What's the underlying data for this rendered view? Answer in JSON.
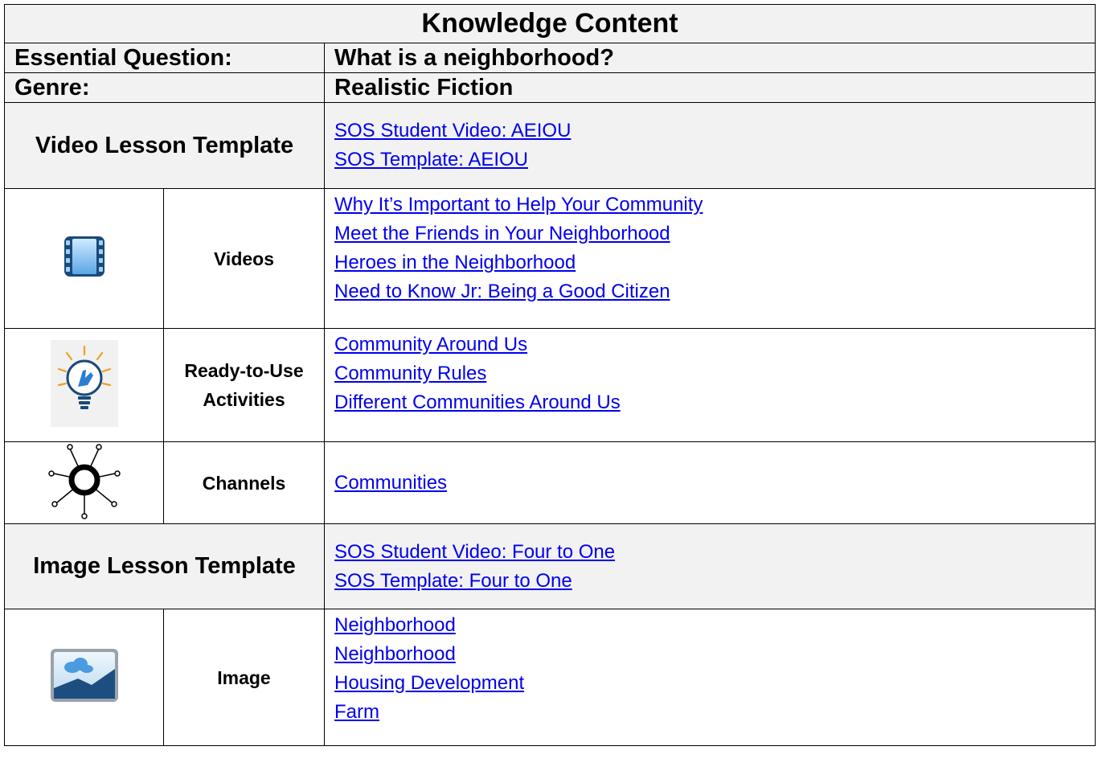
{
  "title": "Knowledge Content",
  "essential_question": {
    "label": "Essential Question:",
    "value": "What is a neighborhood?"
  },
  "genre": {
    "label": "Genre:",
    "value": "Realistic Fiction"
  },
  "video_lesson": {
    "label": "Video Lesson Template",
    "links": [
      "SOS Student Video:  AEIOU",
      "SOS Template:  AEIOU"
    ]
  },
  "videos": {
    "label": "Videos",
    "icon": "film-strip-icon",
    "links": [
      "Why It’s Important to Help Your Community",
      "Meet the Friends in Your Neighborhood",
      "Heroes in the Neighborhood",
      "Need to Know Jr:  Being a Good Citizen"
    ]
  },
  "activities": {
    "label_line1": "Ready-to-Use",
    "label_line2": "Activities",
    "icon": "lightbulb-hand-icon",
    "links": [
      "Community Around Us",
      "Community Rules",
      "Different Communities Around Us"
    ]
  },
  "channels": {
    "label": "Channels",
    "icon": "hub-network-icon",
    "links": [
      "Communities"
    ]
  },
  "image_lesson": {
    "label": "Image Lesson Template",
    "links": [
      "SOS Student Video:  Four to One",
      "SOS Template:  Four to One"
    ]
  },
  "images": {
    "label": "Image",
    "icon": "image-landscape-icon",
    "links": [
      "Neighborhood",
      "Neighborhood",
      "Housing Development",
      "Farm"
    ]
  },
  "colors": {
    "header_bg": "#f2f2f2",
    "link": "#0000ee"
  }
}
